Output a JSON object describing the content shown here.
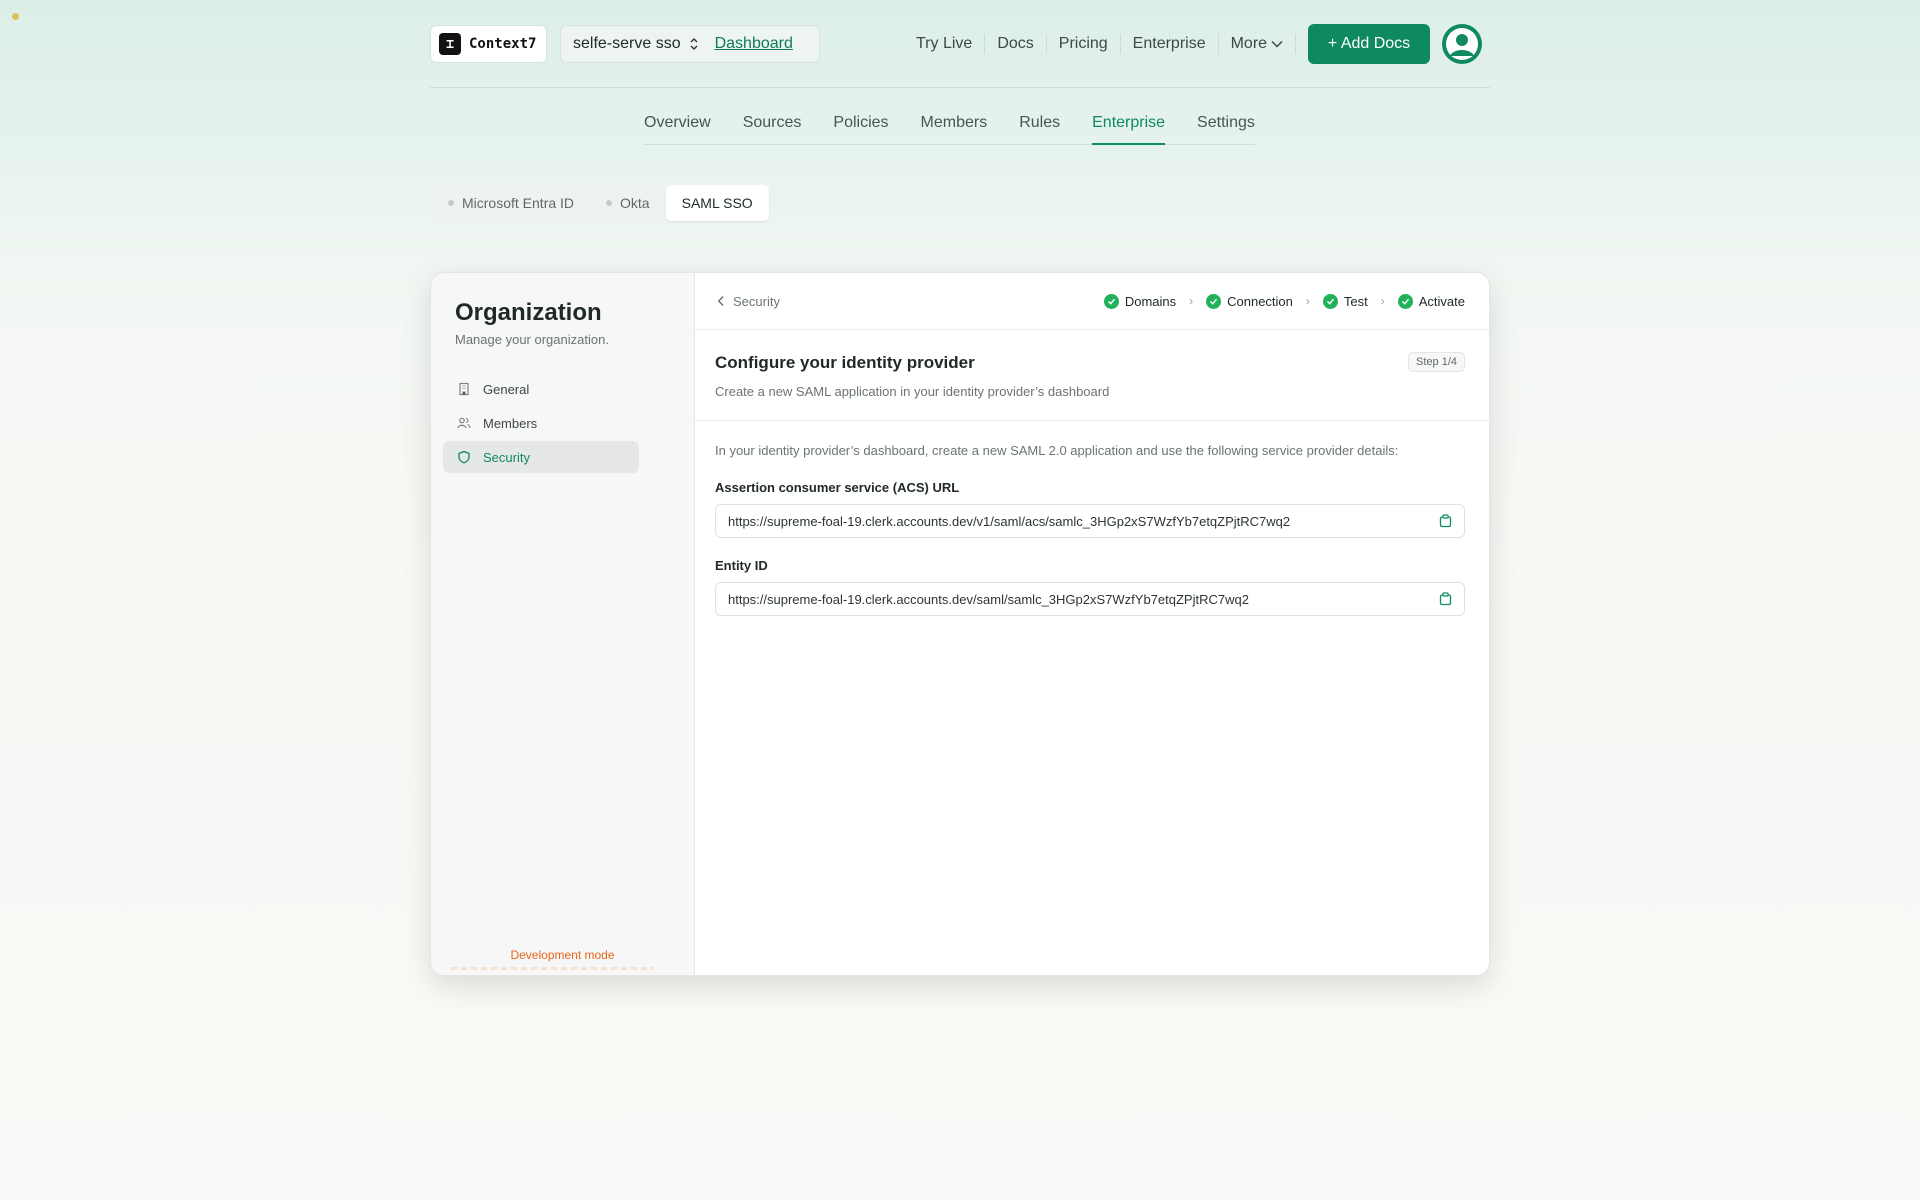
{
  "header": {
    "logo_text": "Context7",
    "project_name": "selfe-serve sso",
    "dashboard_link": "Dashboard",
    "nav": [
      "Try Live",
      "Docs",
      "Pricing",
      "Enterprise"
    ],
    "more_label": "More",
    "add_docs_label": "+ Add Docs"
  },
  "main_tabs": [
    "Overview",
    "Sources",
    "Policies",
    "Members",
    "Rules",
    "Enterprise",
    "Settings"
  ],
  "active_main_tab": "Enterprise",
  "sub_tabs": [
    "Microsoft Entra ID",
    "Okta",
    "SAML SSO"
  ],
  "active_sub_tab": "SAML SSO",
  "organization": {
    "title": "Organization",
    "subtitle": "Manage your organization.",
    "menu": [
      "General",
      "Members",
      "Security"
    ],
    "active_item": "Security",
    "dev_mode": "Development mode"
  },
  "wizard": {
    "back_label": "Security",
    "steps": [
      "Domains",
      "Connection",
      "Test",
      "Activate"
    ],
    "title": "Configure your identity provider",
    "description": "Create a new SAML application in your identity provider’s dashboard",
    "step_badge": "Step 1/4",
    "intro": "In your identity provider’s dashboard, create a new SAML 2.0 application and use the following service provider details:",
    "acs_label": "Assertion consumer service (ACS) URL",
    "acs_value": "https://supreme-foal-19.clerk.accounts.dev/v1/saml/acs/samlc_3HGp2xS7WzfYb7etqZPjtRC7wq2",
    "entity_label": "Entity ID",
    "entity_value": "https://supreme-foal-19.clerk.accounts.dev/saml/samlc_3HGp2xS7WzfYb7etqZPjtRC7wq2"
  },
  "colors": {
    "accent": "#0f8a60",
    "check": "#20b15a",
    "dev_mode": "#e8651d"
  }
}
